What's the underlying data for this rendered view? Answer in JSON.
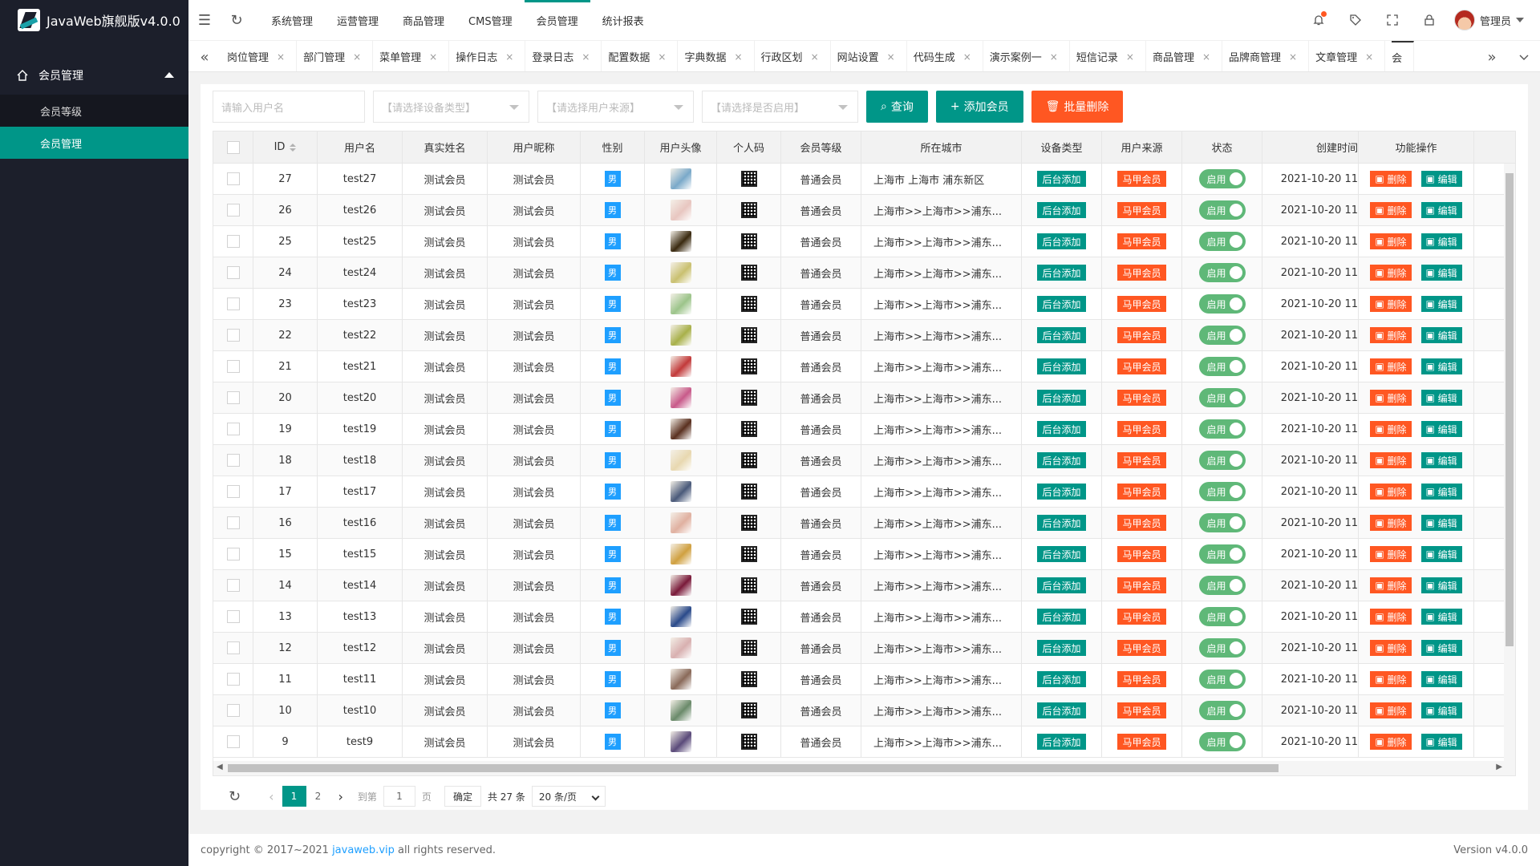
{
  "app": {
    "title": "JavaWeb旗舰版v4.0.0"
  },
  "sidebar": {
    "group_label": "会员管理",
    "items": [
      {
        "label": "会员等级",
        "active": false
      },
      {
        "label": "会员管理",
        "active": true
      }
    ]
  },
  "topnav": {
    "items": [
      "系统管理",
      "运营管理",
      "商品管理",
      "CMS管理",
      "会员管理",
      "统计报表"
    ],
    "active": "会员管理",
    "admin_label": "管理员"
  },
  "tabs": [
    "岗位管理",
    "部门管理",
    "菜单管理",
    "操作日志",
    "登录日志",
    "配置数据",
    "字典数据",
    "行政区划",
    "网站设置",
    "代码生成",
    "演示案例一",
    "短信记录",
    "商品管理",
    "品牌商管理",
    "文章管理",
    "会"
  ],
  "toolbar": {
    "username_placeholder": "请输入用户名",
    "device_select": "【请选择设备类型】",
    "source_select": "【请选择用户来源】",
    "enabled_select": "【请选择是否启用】",
    "query_label": "查询",
    "add_label": "添加会员",
    "batch_delete_label": "批量删除"
  },
  "table": {
    "headers": [
      "ID",
      "用户名",
      "真实姓名",
      "用户昵称",
      "性别",
      "用户头像",
      "个人码",
      "会员等级",
      "所在城市",
      "设备类型",
      "用户来源",
      "状态",
      "创建时间",
      "功能操作"
    ],
    "rows": [
      {
        "id": "27",
        "username": "test27",
        "realname": "测试会员",
        "nickname": "测试会员",
        "gender": "男",
        "level": "普通会员",
        "city": "上海市 上海市 浦东新区",
        "device": "后台添加",
        "source": "马甲会员",
        "status": "启用",
        "created": "2021-10-20 11",
        "del": "删除",
        "edit": "编辑"
      },
      {
        "id": "26",
        "username": "test26",
        "realname": "测试会员",
        "nickname": "测试会员",
        "gender": "男",
        "level": "普通会员",
        "city": "上海市>>上海市>>浦东...",
        "device": "后台添加",
        "source": "马甲会员",
        "status": "启用",
        "created": "2021-10-20 11",
        "del": "删除",
        "edit": "编辑"
      },
      {
        "id": "25",
        "username": "test25",
        "realname": "测试会员",
        "nickname": "测试会员",
        "gender": "男",
        "level": "普通会员",
        "city": "上海市>>上海市>>浦东...",
        "device": "后台添加",
        "source": "马甲会员",
        "status": "启用",
        "created": "2021-10-20 11",
        "del": "删除",
        "edit": "编辑"
      },
      {
        "id": "24",
        "username": "test24",
        "realname": "测试会员",
        "nickname": "测试会员",
        "gender": "男",
        "level": "普通会员",
        "city": "上海市>>上海市>>浦东...",
        "device": "后台添加",
        "source": "马甲会员",
        "status": "启用",
        "created": "2021-10-20 11",
        "del": "删除",
        "edit": "编辑"
      },
      {
        "id": "23",
        "username": "test23",
        "realname": "测试会员",
        "nickname": "测试会员",
        "gender": "男",
        "level": "普通会员",
        "city": "上海市>>上海市>>浦东...",
        "device": "后台添加",
        "source": "马甲会员",
        "status": "启用",
        "created": "2021-10-20 11",
        "del": "删除",
        "edit": "编辑"
      },
      {
        "id": "22",
        "username": "test22",
        "realname": "测试会员",
        "nickname": "测试会员",
        "gender": "男",
        "level": "普通会员",
        "city": "上海市>>上海市>>浦东...",
        "device": "后台添加",
        "source": "马甲会员",
        "status": "启用",
        "created": "2021-10-20 11",
        "del": "删除",
        "edit": "编辑"
      },
      {
        "id": "21",
        "username": "test21",
        "realname": "测试会员",
        "nickname": "测试会员",
        "gender": "男",
        "level": "普通会员",
        "city": "上海市>>上海市>>浦东...",
        "device": "后台添加",
        "source": "马甲会员",
        "status": "启用",
        "created": "2021-10-20 11",
        "del": "删除",
        "edit": "编辑"
      },
      {
        "id": "20",
        "username": "test20",
        "realname": "测试会员",
        "nickname": "测试会员",
        "gender": "男",
        "level": "普通会员",
        "city": "上海市>>上海市>>浦东...",
        "device": "后台添加",
        "source": "马甲会员",
        "status": "启用",
        "created": "2021-10-20 11",
        "del": "删除",
        "edit": "编辑"
      },
      {
        "id": "19",
        "username": "test19",
        "realname": "测试会员",
        "nickname": "测试会员",
        "gender": "男",
        "level": "普通会员",
        "city": "上海市>>上海市>>浦东...",
        "device": "后台添加",
        "source": "马甲会员",
        "status": "启用",
        "created": "2021-10-20 11",
        "del": "删除",
        "edit": "编辑"
      },
      {
        "id": "18",
        "username": "test18",
        "realname": "测试会员",
        "nickname": "测试会员",
        "gender": "男",
        "level": "普通会员",
        "city": "上海市>>上海市>>浦东...",
        "device": "后台添加",
        "source": "马甲会员",
        "status": "启用",
        "created": "2021-10-20 11",
        "del": "删除",
        "edit": "编辑"
      },
      {
        "id": "17",
        "username": "test17",
        "realname": "测试会员",
        "nickname": "测试会员",
        "gender": "男",
        "level": "普通会员",
        "city": "上海市>>上海市>>浦东...",
        "device": "后台添加",
        "source": "马甲会员",
        "status": "启用",
        "created": "2021-10-20 11",
        "del": "删除",
        "edit": "编辑"
      },
      {
        "id": "16",
        "username": "test16",
        "realname": "测试会员",
        "nickname": "测试会员",
        "gender": "男",
        "level": "普通会员",
        "city": "上海市>>上海市>>浦东...",
        "device": "后台添加",
        "source": "马甲会员",
        "status": "启用",
        "created": "2021-10-20 11",
        "del": "删除",
        "edit": "编辑"
      },
      {
        "id": "15",
        "username": "test15",
        "realname": "测试会员",
        "nickname": "测试会员",
        "gender": "男",
        "level": "普通会员",
        "city": "上海市>>上海市>>浦东...",
        "device": "后台添加",
        "source": "马甲会员",
        "status": "启用",
        "created": "2021-10-20 11",
        "del": "删除",
        "edit": "编辑"
      },
      {
        "id": "14",
        "username": "test14",
        "realname": "测试会员",
        "nickname": "测试会员",
        "gender": "男",
        "level": "普通会员",
        "city": "上海市>>上海市>>浦东...",
        "device": "后台添加",
        "source": "马甲会员",
        "status": "启用",
        "created": "2021-10-20 11",
        "del": "删除",
        "edit": "编辑"
      },
      {
        "id": "13",
        "username": "test13",
        "realname": "测试会员",
        "nickname": "测试会员",
        "gender": "男",
        "level": "普通会员",
        "city": "上海市>>上海市>>浦东...",
        "device": "后台添加",
        "source": "马甲会员",
        "status": "启用",
        "created": "2021-10-20 11",
        "del": "删除",
        "edit": "编辑"
      },
      {
        "id": "12",
        "username": "test12",
        "realname": "测试会员",
        "nickname": "测试会员",
        "gender": "男",
        "level": "普通会员",
        "city": "上海市>>上海市>>浦东...",
        "device": "后台添加",
        "source": "马甲会员",
        "status": "启用",
        "created": "2021-10-20 11",
        "del": "删除",
        "edit": "编辑"
      },
      {
        "id": "11",
        "username": "test11",
        "realname": "测试会员",
        "nickname": "测试会员",
        "gender": "男",
        "level": "普通会员",
        "city": "上海市>>上海市>>浦东...",
        "device": "后台添加",
        "source": "马甲会员",
        "status": "启用",
        "created": "2021-10-20 11",
        "del": "删除",
        "edit": "编辑"
      },
      {
        "id": "10",
        "username": "test10",
        "realname": "测试会员",
        "nickname": "测试会员",
        "gender": "男",
        "level": "普通会员",
        "city": "上海市>>上海市>>浦东...",
        "device": "后台添加",
        "source": "马甲会员",
        "status": "启用",
        "created": "2021-10-20 11",
        "del": "删除",
        "edit": "编辑"
      },
      {
        "id": "9",
        "username": "test9",
        "realname": "测试会员",
        "nickname": "测试会员",
        "gender": "男",
        "level": "普通会员",
        "city": "上海市>>上海市>>浦东...",
        "device": "后台添加",
        "source": "马甲会员",
        "status": "启用",
        "created": "2021-10-20 11",
        "del": "删除",
        "edit": "编辑"
      }
    ]
  },
  "pagination": {
    "pages": [
      "1",
      "2"
    ],
    "current": "1",
    "goto_label": "到第",
    "page_input": "1",
    "page_suffix": "页",
    "confirm_label": "确定",
    "total": "共 27 条",
    "page_size": "20 条/页"
  },
  "footer": {
    "copyright_prefix": "copyright © 2017~2021",
    "site": "javaweb.vip",
    "copyright_suffix": "all rights reserved.",
    "version": "Version v4.0.0"
  },
  "colors": {
    "sidebar_bg": "#1c1f2b",
    "accent": "#009688",
    "danger": "#ff5722",
    "info": "#1e9fff",
    "switch_on": "#5fb878"
  },
  "thumb_colors": [
    "#7aa9c9",
    "#e8c6c0",
    "#3a2a10",
    "#c9c070",
    "#9cc48a",
    "#a8b04a",
    "#c23a3a",
    "#c85a8a",
    "#5a3020",
    "#e8d8b0",
    "#4a5a7a",
    "#e0b0a0",
    "#d0a040",
    "#7a1a3a",
    "#2a4a8a",
    "#d8b0b0",
    "#8a6a5a",
    "#6a8a6a",
    "#5a4a7a"
  ]
}
